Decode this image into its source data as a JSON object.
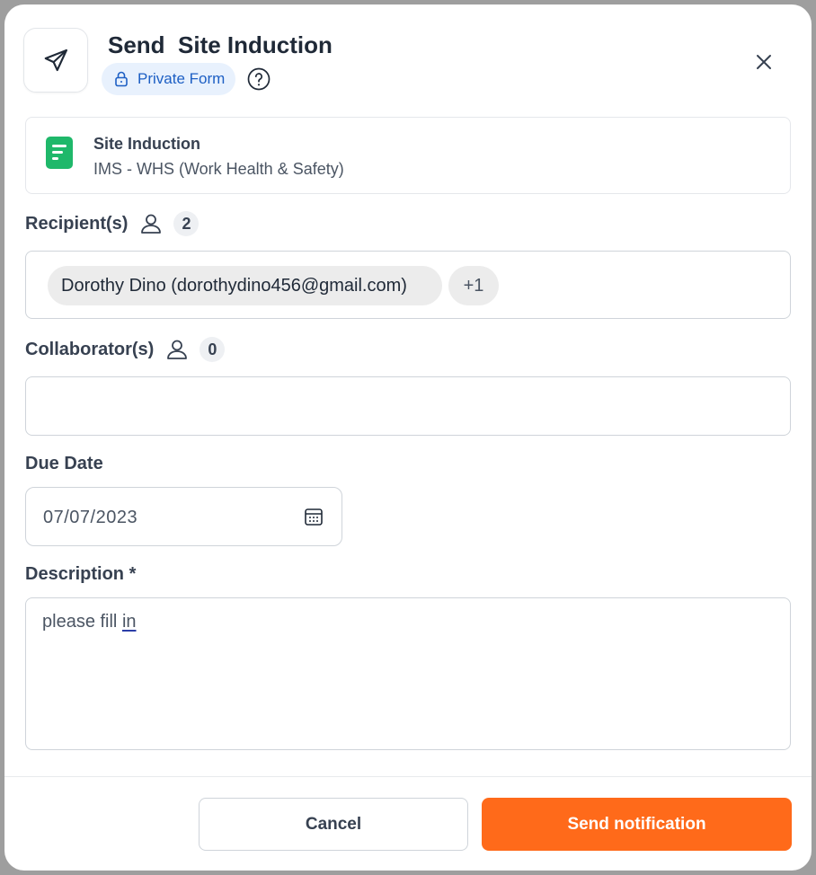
{
  "header": {
    "title": "Send  Site Induction",
    "badge_label": "Private Form",
    "icons": {
      "send": "send-icon",
      "lock": "lock-icon",
      "help": "help-circle-icon",
      "close": "close-icon"
    }
  },
  "form_card": {
    "name": "Site Induction",
    "category": "IMS - WHS (Work Health & Safety)",
    "icon": "document-icon",
    "icon_color": "#1fb86a"
  },
  "recipients": {
    "label": "Recipient(s)",
    "count": "2",
    "chips": [
      "Dorothy Dino (dorothydino456@gmail.com)"
    ],
    "more_label": "+1"
  },
  "collaborators": {
    "label": "Collaborator(s)",
    "count": "0"
  },
  "due_date": {
    "label": "Due Date",
    "value": "07/07/2023"
  },
  "description": {
    "label": "Description *",
    "text_before": "please fill ",
    "text_flagged": "in"
  },
  "footer": {
    "cancel_label": "Cancel",
    "send_label": "Send notification"
  },
  "colors": {
    "accent": "#ff6a1a",
    "badge_bg": "#e8f1fd",
    "badge_text": "#1d5fc4"
  }
}
